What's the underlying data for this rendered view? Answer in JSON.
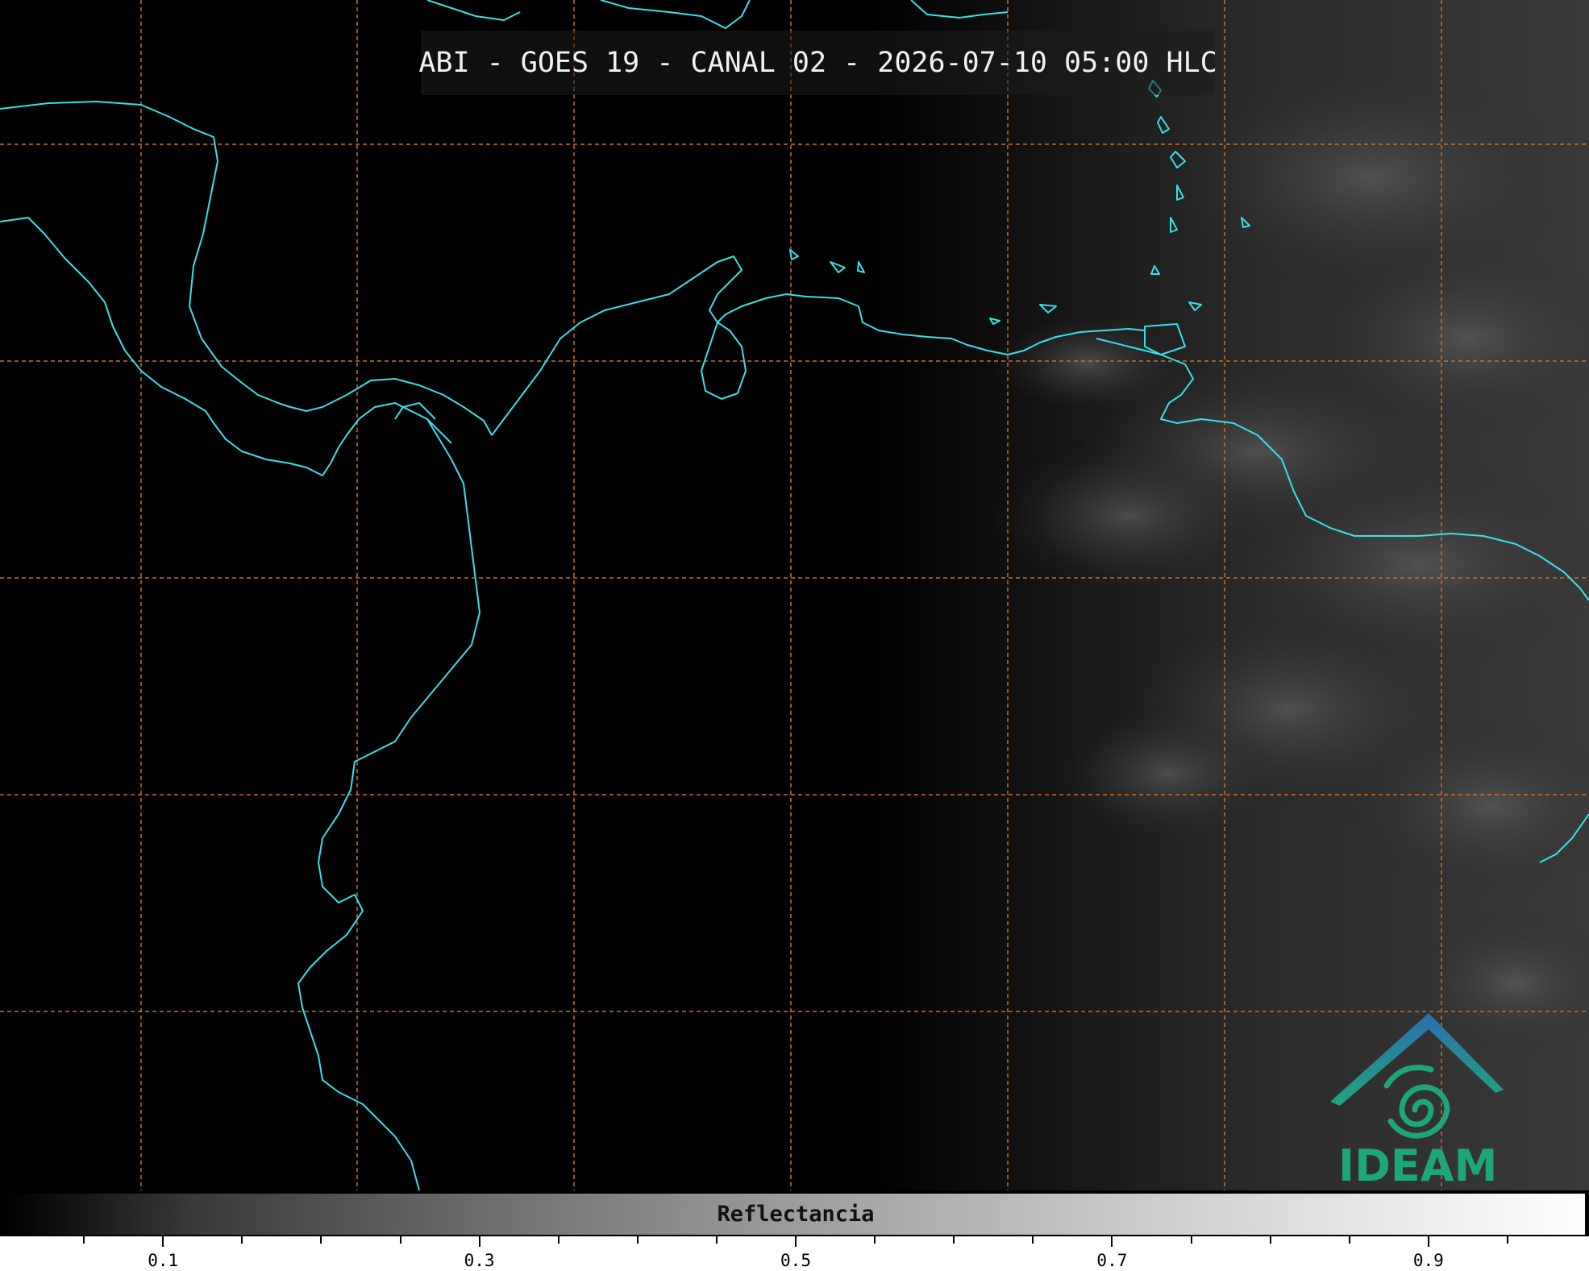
{
  "map": {
    "title": "ABI - GOES 19 - CANAL 02 - 2026-07-10 05:00 HLC",
    "gridline_color": "#c8702a",
    "coastline_color": "#38e0e8",
    "background_color": "#000000"
  },
  "colorbar": {
    "label": "Reflectancia",
    "tick_labels": [
      "0.1",
      "0.3",
      "0.5",
      "0.7",
      "0.9"
    ],
    "range": [
      0.0,
      1.0
    ],
    "tick_values": [
      0.1,
      0.3,
      0.5,
      0.7,
      0.9
    ]
  },
  "logo": {
    "text": "IDEAM",
    "colors": [
      "#2c6fb0",
      "#1fa57a"
    ]
  }
}
